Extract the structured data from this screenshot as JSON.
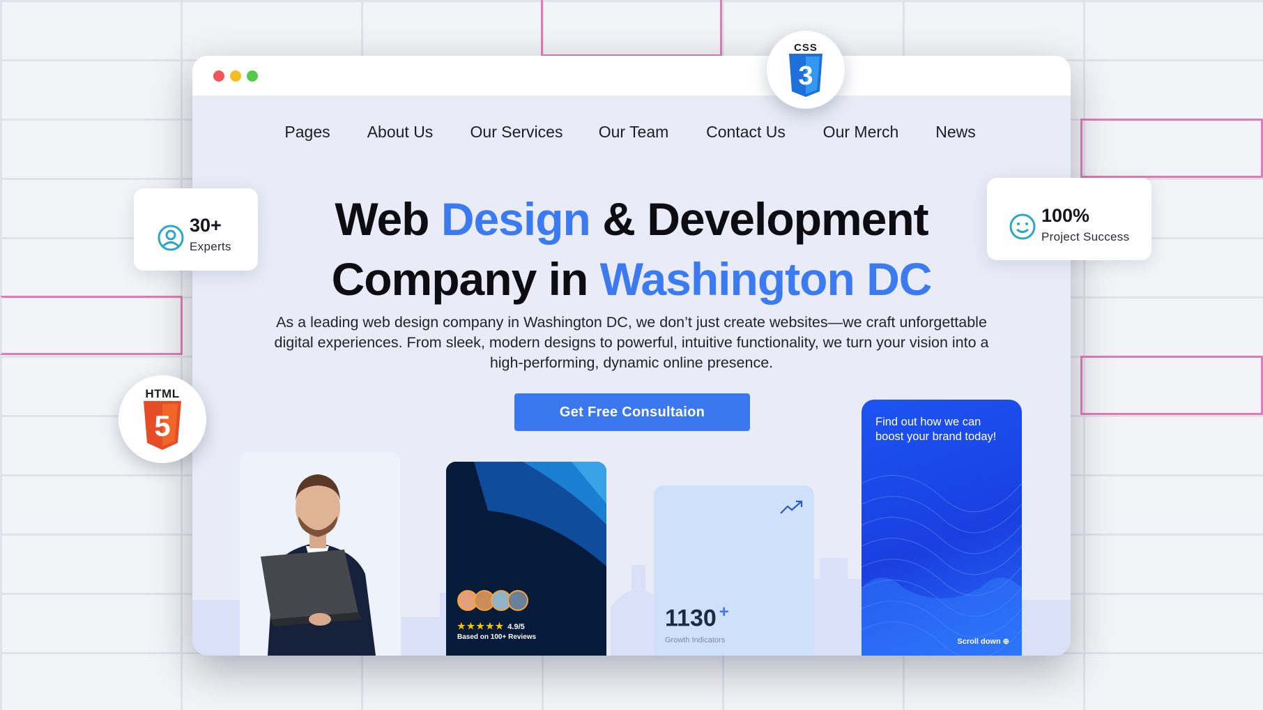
{
  "nav": {
    "items": [
      "Pages",
      "About Us",
      "Our Services",
      "Our Team",
      "Contact Us",
      "Our Merch",
      "News"
    ]
  },
  "hero": {
    "line1_a": "Web ",
    "line1_b": "Design",
    "line1_c": " & Development",
    "line2_a": "Company in ",
    "line2_b": "Washington DC",
    "description": "As a leading web design company in Washington DC, we don’t just create websites—we craft unforgettable digital experiences. From sleek, modern designs to powerful, intuitive functionality, we turn your vision into a high-performing, dynamic online presence.",
    "cta": "Get Free Consultaion"
  },
  "badges": {
    "experts_num": "30+",
    "experts_label": "Experts",
    "success_num": "100%",
    "success_label": "Project Success"
  },
  "logos": {
    "css": "CSS",
    "css_number": "3",
    "html": "HTML",
    "html_number": "5"
  },
  "reviews_card": {
    "rating": "4.9/5",
    "stars": "★★★★★",
    "based_on": "Based on 100+ Reviews"
  },
  "growth_card": {
    "number": "1130",
    "plus": "+",
    "label": "Growth Indicators"
  },
  "promo_card": {
    "text": "Find out how we can boost your brand today!",
    "scroll": "Scroll down"
  },
  "colors": {
    "accent": "#3b78ef",
    "window_bg": "#e9ecf7",
    "promo_blue": "#1c54f2"
  },
  "icons": [
    "user-circle-icon",
    "smiley-icon",
    "trend-up-icon",
    "scroll-down-icon",
    "css3-logo",
    "html5-logo"
  ]
}
